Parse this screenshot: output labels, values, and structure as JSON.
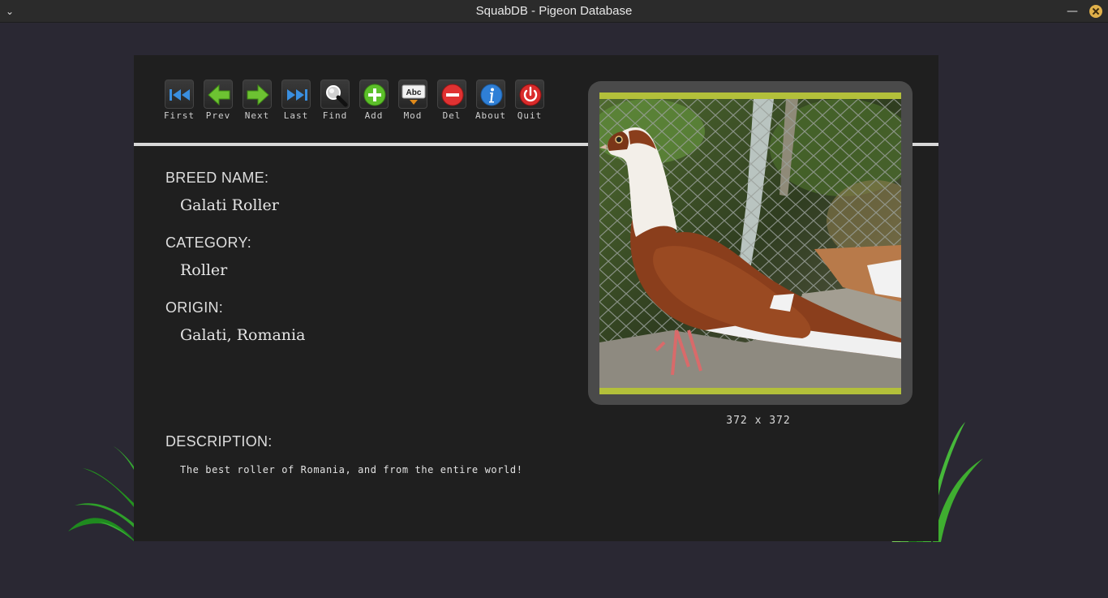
{
  "window": {
    "title": "SquabDB - Pigeon Database"
  },
  "toolbar": {
    "buttons": [
      {
        "label": "First",
        "icon": "first-record-icon"
      },
      {
        "label": "Prev",
        "icon": "left-arrow-icon"
      },
      {
        "label": "Next",
        "icon": "right-arrow-icon"
      },
      {
        "label": "Last",
        "icon": "last-record-icon"
      },
      {
        "label": "Find",
        "icon": "magnifier-icon"
      },
      {
        "label": "Add",
        "icon": "plus-icon"
      },
      {
        "label": "Mod",
        "icon": "edit-text-icon"
      },
      {
        "label": "Del",
        "icon": "minus-icon"
      },
      {
        "label": "About",
        "icon": "info-icon"
      },
      {
        "label": "Quit",
        "icon": "power-icon"
      }
    ]
  },
  "record": {
    "breed_label": "BREED NAME:",
    "breed_value": "Galati Roller",
    "category_label": "CATEGORY:",
    "category_value": "Roller",
    "origin_label": "ORIGIN:",
    "origin_value": "Galati, Romania",
    "description_label": "DESCRIPTION:",
    "description_value": "The best roller of Romania, and from the entire world!"
  },
  "image": {
    "dimensions": "372 x 372",
    "subject": "pigeon-photo"
  },
  "colors": {
    "background": "#2a2833",
    "panel": "#1f1f1f",
    "accent_frame": "#b3c03a",
    "frame_gray": "#4a4a4a"
  }
}
